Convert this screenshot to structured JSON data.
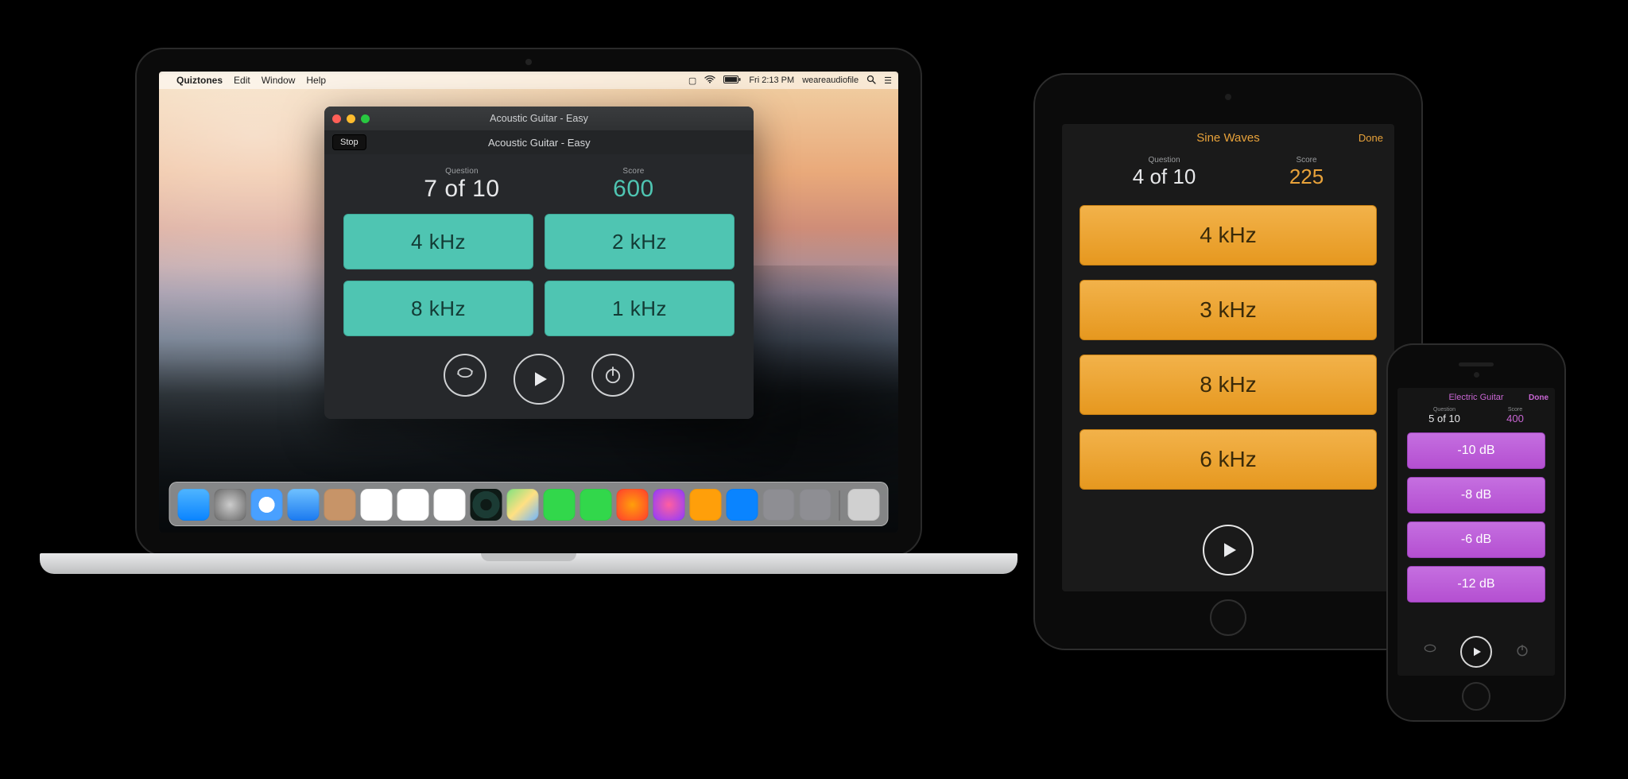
{
  "mac": {
    "menubar": {
      "app": "Quiztones",
      "items": [
        "Edit",
        "Window",
        "Help"
      ],
      "clock": "Fri 2:13 PM",
      "user": "weareaudiofile"
    },
    "window": {
      "title_ghost": "Acoustic Guitar - Easy",
      "stop": "Stop",
      "quiz_title": "Acoustic Guitar - Easy",
      "question_label": "Question",
      "question_value": "7 of 10",
      "score_label": "Score",
      "score_value": "600",
      "answers": [
        "4 kHz",
        "2 kHz",
        "8 kHz",
        "1 kHz"
      ]
    },
    "dock": [
      "finder",
      "launchpad",
      "safari",
      "mail",
      "contacts",
      "calendar",
      "notes",
      "reminders",
      "quiztones",
      "maps",
      "messages",
      "facetime",
      "photobooth",
      "itunes",
      "ibooks",
      "appstore",
      "preferences",
      "other",
      "trash"
    ]
  },
  "ipad": {
    "title": "Sine Waves",
    "done": "Done",
    "question_label": "Question",
    "question_value": "4 of 10",
    "score_label": "Score",
    "score_value": "225",
    "answers": [
      "4 kHz",
      "3 kHz",
      "8 kHz",
      "6 kHz"
    ]
  },
  "iphone": {
    "title": "Electric Guitar",
    "done": "Done",
    "question_label": "Question",
    "question_value": "5 of 10",
    "score_label": "Score",
    "score_value": "400",
    "answers": [
      "-10 dB",
      "-8 dB",
      "-6 dB",
      "-12 dB"
    ]
  }
}
